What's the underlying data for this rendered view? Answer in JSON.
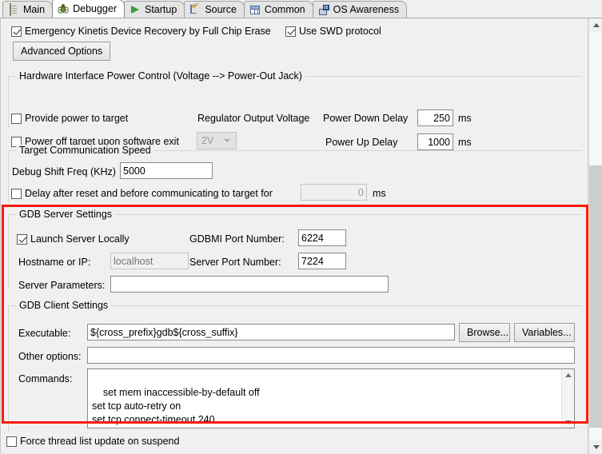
{
  "tabs": [
    {
      "label": "Main",
      "icon": "document-icon",
      "active": false
    },
    {
      "label": "Debugger",
      "icon": "bug-icon",
      "active": true
    },
    {
      "label": "Startup",
      "icon": "play-icon",
      "active": false
    },
    {
      "label": "Source",
      "icon": "source-pencil-icon",
      "active": false
    },
    {
      "label": "Common",
      "icon": "table-icon",
      "active": false
    },
    {
      "label": "OS Awareness",
      "icon": "os-monitor-icon",
      "active": false
    }
  ],
  "top": {
    "emergency_erase_label": "Emergency Kinetis Device Recovery by Full Chip Erase",
    "emergency_erase_checked": true,
    "use_swd_label": "Use SWD protocol",
    "use_swd_checked": true,
    "advanced_options_label": "Advanced Options"
  },
  "power_group": {
    "title": "Hardware Interface Power Control (Voltage --> Power-Out Jack)",
    "provide_power_label": "Provide power to target",
    "provide_power_checked": false,
    "power_off_exit_label": "Power off target upon software exit",
    "power_off_exit_checked": false,
    "regulator_label": "Regulator Output Voltage",
    "regulator_value": "2V",
    "power_down_delay_label": "Power Down Delay",
    "power_down_delay_value": "250",
    "power_down_delay_unit": "ms",
    "power_up_delay_label": "Power Up Delay",
    "power_up_delay_value": "1000",
    "power_up_delay_unit": "ms"
  },
  "speed_group": {
    "title": "Target Communication Speed",
    "debug_shift_label": "Debug Shift Freq (KHz)",
    "debug_shift_value": "5000",
    "delay_after_reset_label": "Delay after reset and before communicating to target for",
    "delay_after_reset_checked": false,
    "delay_after_reset_value": "0",
    "delay_after_reset_unit": "ms"
  },
  "gdb_server": {
    "title": "GDB Server Settings",
    "launch_locally_label": "Launch Server Locally",
    "launch_locally_checked": true,
    "gdbmi_port_label": "GDBMI Port Number:",
    "gdbmi_port_value": "6224",
    "hostname_label": "Hostname or IP:",
    "hostname_placeholder": "localhost",
    "hostname_value": "",
    "server_port_label": "Server Port Number:",
    "server_port_value": "7224",
    "server_params_label": "Server Parameters:",
    "server_params_value": ""
  },
  "gdb_client": {
    "title": "GDB Client Settings",
    "executable_label": "Executable:",
    "executable_value": "${cross_prefix}gdb${cross_suffix}",
    "browse_label": "Browse...",
    "variables_label": "Variables...",
    "other_options_label": "Other options:",
    "other_options_value": "",
    "commands_label": "Commands:",
    "commands_value": "set mem inaccessible-by-default off\nset tcp auto-retry on\nset tcp connect-timeout 240"
  },
  "footer": {
    "force_thread_label": "Force thread list update on suspend",
    "force_thread_checked": false
  },
  "highlight": {
    "color": "#fb1a09"
  }
}
